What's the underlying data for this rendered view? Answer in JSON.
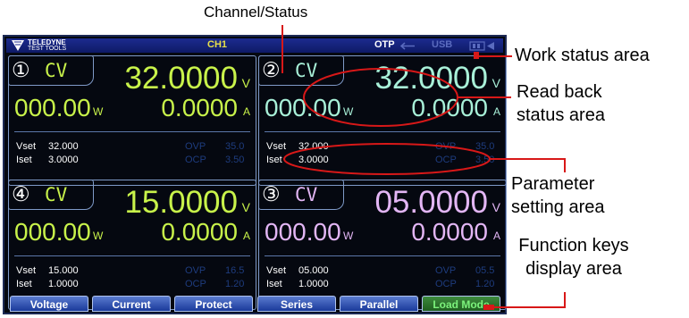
{
  "annotations": {
    "channel_status": "Channel/Status",
    "work_status": "Work status area",
    "readback": "Read back status area",
    "param": "Parameter setting area",
    "fkeys": "Function keys display area"
  },
  "topbar": {
    "logo_line1": "TELEDYNE",
    "logo_line2": "TEST TOOLS",
    "channel": "CH1",
    "otp": "OTP",
    "usb": "USB"
  },
  "channels": [
    {
      "num": "①",
      "mode": "CV",
      "voltage": "32.0000",
      "vunit": "V",
      "power": "000.00",
      "punit": "W",
      "current": "0.0000",
      "aunit": "A",
      "vset_label": "Vset",
      "vset": "32.000",
      "iset_label": "Iset",
      "iset": "3.0000",
      "ovp_label": "OVP",
      "ovp": "35.0",
      "ocp_label": "OCP",
      "ocp": "3.50"
    },
    {
      "num": "②",
      "mode": "CV",
      "voltage": "32.0000",
      "vunit": "V",
      "power": "000.00",
      "punit": "W",
      "current": "0.0000",
      "aunit": "A",
      "vset_label": "Vset",
      "vset": "32.000",
      "iset_label": "Iset",
      "iset": "3.0000",
      "ovp_label": "OVP",
      "ovp": "35.0",
      "ocp_label": "OCP",
      "ocp": "3.50"
    },
    {
      "num": "④",
      "mode": "CV",
      "voltage": "15.0000",
      "vunit": "V",
      "power": "000.00",
      "punit": "W",
      "current": "0.0000",
      "aunit": "A",
      "vset_label": "Vset",
      "vset": "15.000",
      "iset_label": "Iset",
      "iset": "1.0000",
      "ovp_label": "OVP",
      "ovp": "16.5",
      "ocp_label": "OCP",
      "ocp": "1.20"
    },
    {
      "num": "③",
      "mode": "CV",
      "voltage": "05.0000",
      "vunit": "V",
      "power": "000.00",
      "punit": "W",
      "current": "0.0000",
      "aunit": "A",
      "vset_label": "Vset",
      "vset": "05.000",
      "iset_label": "Iset",
      "iset": "1.0000",
      "ovp_label": "OVP",
      "ovp": "05.5",
      "ocp_label": "OCP",
      "ocp": "1.20"
    }
  ],
  "function_keys": [
    "Voltage",
    "Current",
    "Protect",
    "Series",
    "Parallel",
    "Load Mode"
  ],
  "colors": {
    "ch1": "#c8f24a",
    "ch2": "#a8f0d8",
    "ch4": "#c8f24a",
    "ch3": "#e3b6f5",
    "annotation": "#d81818",
    "screen_bg": "#050810",
    "topbar": "#1c2b8f"
  },
  "icons": [
    "teledyne-logo-icon",
    "usb-arrow-icon",
    "battery-icon"
  ]
}
